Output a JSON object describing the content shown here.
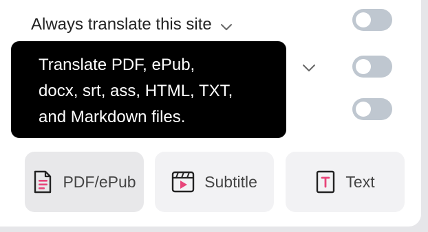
{
  "settings": {
    "rows": [
      {
        "label": "Always translate this site",
        "has_dropdown": true,
        "toggle_on": false
      },
      {
        "label": "",
        "has_dropdown": true,
        "toggle_on": false
      },
      {
        "label": "",
        "has_dropdown": false,
        "toggle_on": false
      }
    ]
  },
  "tooltip": {
    "lines": [
      "Translate PDF, ePub,",
      "docx, srt, ass, HTML, TXT,",
      "and Markdown files."
    ]
  },
  "file_buttons": [
    {
      "label": "PDF/ePub",
      "icon": "document-icon"
    },
    {
      "label": "Subtitle",
      "icon": "video-icon"
    },
    {
      "label": "Text",
      "icon": "text-file-icon"
    }
  ],
  "colors": {
    "accent_pink": "#e8457a",
    "toggle_off": "#bfc7d0",
    "tooltip_bg": "#000000"
  }
}
